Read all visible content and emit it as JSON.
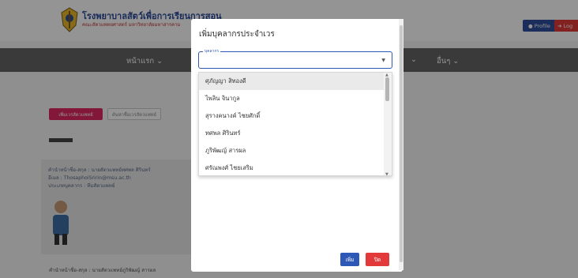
{
  "header": {
    "site_title": "โรงพยาบาลสัตว์เพื่อการเรียนการสอน",
    "site_subtitle": "คณะสัตวแพทยศาสตร์ มหาวิทยาลัยมหาสารคาม",
    "profile_label": "Profile",
    "logout_label": "Log"
  },
  "nav": {
    "home": "หน้าแรก ⌄",
    "menu_hidden": "⌄",
    "other": "อื่นๆ ⌄"
  },
  "tabs": {
    "add_vet": "เพิ่มเวรสัตวแพทย์",
    "search_vet": "ค้นหาชื่อเวรสัตวแพทย์"
  },
  "card": {
    "name_line": "คำนำหน้าชื่อ-สกุล : นายสัตวแพทย์ทศพล ศิรินทร์",
    "email_line": "อีเมล : ThosaphoiSririn@msu.ac.th",
    "type_line": "ประเภทบุคลากร : ทีมสัตวแพทย์"
  },
  "bottom_line": "คำนำหน้าชื่อ-สกุล : นายสัตวแพทย์ภูริพัฒญ์ สารผล",
  "modal": {
    "title": "เพิ่มบุคลากรประจำเวร",
    "select_legend": "บุคลากร",
    "dropdown_items": [
      "ศุภัญญา สิทองดี",
      "ไพลิน จินากูล",
      "สุรางคนางค์ ไชยศักดิ์",
      "ทศพล ศิรินทร์",
      "ภูริพัฒญ์ สารผล",
      "ศรัณพงศ์ ไชยเสริม"
    ],
    "add_button": "เพิ่ม",
    "close_button": "ปิด"
  },
  "colors": {
    "primary": "#2e58b6",
    "danger": "#e23a3a",
    "accent_pink": "#e22864",
    "navbar": "#646464"
  }
}
